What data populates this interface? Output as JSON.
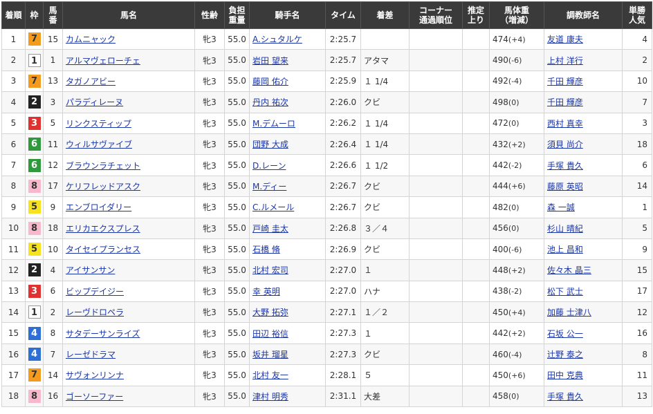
{
  "headers": {
    "rank": "着順",
    "waku": "枠",
    "umaban": [
      "馬",
      "番"
    ],
    "horse": "馬名",
    "sexage": "性齢",
    "weight": [
      "負担",
      "重量"
    ],
    "jockey": "騎手名",
    "time": "タイム",
    "margin": "着差",
    "corner": [
      "コーナー",
      "通過順位"
    ],
    "agari": [
      "推定",
      "上り"
    ],
    "body": [
      "馬体重",
      "（増減）"
    ],
    "trainer": "調教師名",
    "pop": [
      "単勝",
      "人気"
    ]
  },
  "rows": [
    {
      "rank": "1",
      "waku": "7",
      "umaban": "15",
      "horse": "カムニャック",
      "sexage": "牝3",
      "weight": "55.0",
      "jockey": "A.シュタルケ",
      "time": "2:25.7",
      "margin": "",
      "corner": "",
      "agari": "",
      "body": "474",
      "diff": "(+4)",
      "trainer": "友道 康夫",
      "pop": "4"
    },
    {
      "rank": "2",
      "waku": "1",
      "umaban": "1",
      "horse": "アルマヴェローチェ",
      "sexage": "牝3",
      "weight": "55.0",
      "jockey": "岩田 望来",
      "time": "2:25.7",
      "margin": "アタマ",
      "corner": "",
      "agari": "",
      "body": "490",
      "diff": "(-6)",
      "trainer": "上村 洋行",
      "pop": "2"
    },
    {
      "rank": "3",
      "waku": "7",
      "umaban": "13",
      "horse": "タガノアビー",
      "sexage": "牝3",
      "weight": "55.0",
      "jockey": "藤岡 佑介",
      "time": "2:25.9",
      "margin": "１ 1/4",
      "corner": "",
      "agari": "",
      "body": "492",
      "diff": "(-4)",
      "trainer": "千田 輝彦",
      "pop": "10"
    },
    {
      "rank": "4",
      "waku": "2",
      "umaban": "3",
      "horse": "パラディレーヌ",
      "sexage": "牝3",
      "weight": "55.0",
      "jockey": "丹内 祐次",
      "time": "2:26.0",
      "margin": "クビ",
      "corner": "",
      "agari": "",
      "body": "498",
      "diff": "(0)",
      "trainer": "千田 輝彦",
      "pop": "7"
    },
    {
      "rank": "5",
      "waku": "3",
      "umaban": "5",
      "horse": "リンクスティップ",
      "sexage": "牝3",
      "weight": "55.0",
      "jockey": "M.デムーロ",
      "time": "2:26.2",
      "margin": "１ 1/4",
      "corner": "",
      "agari": "",
      "body": "472",
      "diff": "(0)",
      "trainer": "西村 真幸",
      "pop": "3"
    },
    {
      "rank": "6",
      "waku": "6",
      "umaban": "11",
      "horse": "ウィルサヴァイブ",
      "sexage": "牝3",
      "weight": "55.0",
      "jockey": "団野 大成",
      "time": "2:26.4",
      "margin": "１ 1/4",
      "corner": "",
      "agari": "",
      "body": "432",
      "diff": "(+2)",
      "trainer": "須貝 尚介",
      "pop": "18"
    },
    {
      "rank": "7",
      "waku": "6",
      "umaban": "12",
      "horse": "ブラウンラチェット",
      "sexage": "牝3",
      "weight": "55.0",
      "jockey": "D.レーン",
      "time": "2:26.6",
      "margin": "１ 1/2",
      "corner": "",
      "agari": "",
      "body": "442",
      "diff": "(-2)",
      "trainer": "手塚 貴久",
      "pop": "6"
    },
    {
      "rank": "8",
      "waku": "8",
      "umaban": "17",
      "horse": "ケリフレッドアスク",
      "sexage": "牝3",
      "weight": "55.0",
      "jockey": "M.ディー",
      "time": "2:26.7",
      "margin": "クビ",
      "corner": "",
      "agari": "",
      "body": "444",
      "diff": "(+6)",
      "trainer": "藤原 英昭",
      "pop": "14"
    },
    {
      "rank": "9",
      "waku": "5",
      "umaban": "9",
      "horse": "エンブロイダリー",
      "sexage": "牝3",
      "weight": "55.0",
      "jockey": "C.ルメール",
      "time": "2:26.7",
      "margin": "クビ",
      "corner": "",
      "agari": "",
      "body": "482",
      "diff": "(0)",
      "trainer": "森 一誠",
      "pop": "1"
    },
    {
      "rank": "10",
      "waku": "8",
      "umaban": "18",
      "horse": "エリカエクスプレス",
      "sexage": "牝3",
      "weight": "55.0",
      "jockey": "戸崎 圭太",
      "time": "2:26.8",
      "margin": "３／４",
      "corner": "",
      "agari": "",
      "body": "456",
      "diff": "(0)",
      "trainer": "杉山 晴紀",
      "pop": "5"
    },
    {
      "rank": "11",
      "waku": "5",
      "umaban": "10",
      "horse": "タイセイプランセス",
      "sexage": "牝3",
      "weight": "55.0",
      "jockey": "石橋 脩",
      "time": "2:26.9",
      "margin": "クビ",
      "corner": "",
      "agari": "",
      "body": "400",
      "diff": "(-6)",
      "trainer": "池上 昌和",
      "pop": "9"
    },
    {
      "rank": "12",
      "waku": "2",
      "umaban": "4",
      "horse": "アイサンサン",
      "sexage": "牝3",
      "weight": "55.0",
      "jockey": "北村 宏司",
      "time": "2:27.0",
      "margin": "１",
      "corner": "",
      "agari": "",
      "body": "448",
      "diff": "(+2)",
      "trainer": "佐々木 晶三",
      "pop": "15"
    },
    {
      "rank": "13",
      "waku": "3",
      "umaban": "6",
      "horse": "ビップデイジー",
      "sexage": "牝3",
      "weight": "55.0",
      "jockey": "幸 英明",
      "time": "2:27.0",
      "margin": "ハナ",
      "corner": "",
      "agari": "",
      "body": "438",
      "diff": "(-2)",
      "trainer": "松下 武士",
      "pop": "17"
    },
    {
      "rank": "14",
      "waku": "1",
      "umaban": "2",
      "horse": "レーヴドロペラ",
      "sexage": "牝3",
      "weight": "55.0",
      "jockey": "大野 拓弥",
      "time": "2:27.1",
      "margin": "１／２",
      "corner": "",
      "agari": "",
      "body": "450",
      "diff": "(+4)",
      "trainer": "加藤 士津八",
      "pop": "12"
    },
    {
      "rank": "15",
      "waku": "4",
      "umaban": "8",
      "horse": "サタデーサンライズ",
      "sexage": "牝3",
      "weight": "55.0",
      "jockey": "田辺 裕信",
      "time": "2:27.3",
      "margin": "１",
      "corner": "",
      "agari": "",
      "body": "442",
      "diff": "(+2)",
      "trainer": "石坂 公一",
      "pop": "16"
    },
    {
      "rank": "16",
      "waku": "4",
      "umaban": "7",
      "horse": "レーゼドラマ",
      "sexage": "牝3",
      "weight": "55.0",
      "jockey": "坂井 瑠星",
      "time": "2:27.3",
      "margin": "クビ",
      "corner": "",
      "agari": "",
      "body": "460",
      "diff": "(-4)",
      "trainer": "辻野 泰之",
      "pop": "8"
    },
    {
      "rank": "17",
      "waku": "7",
      "umaban": "14",
      "horse": "サヴォンリンナ",
      "sexage": "牝3",
      "weight": "55.0",
      "jockey": "北村 友一",
      "time": "2:28.1",
      "margin": "５",
      "corner": "",
      "agari": "",
      "body": "450",
      "diff": "(+6)",
      "trainer": "田中 克典",
      "pop": "11"
    },
    {
      "rank": "18",
      "waku": "8",
      "umaban": "16",
      "horse": "ゴーソーファー",
      "sexage": "牝3",
      "weight": "55.0",
      "jockey": "津村 明秀",
      "time": "2:31.1",
      "margin": "大差",
      "corner": "",
      "agari": "",
      "body": "458",
      "diff": "(0)",
      "trainer": "手塚 貴久",
      "pop": "13"
    }
  ]
}
